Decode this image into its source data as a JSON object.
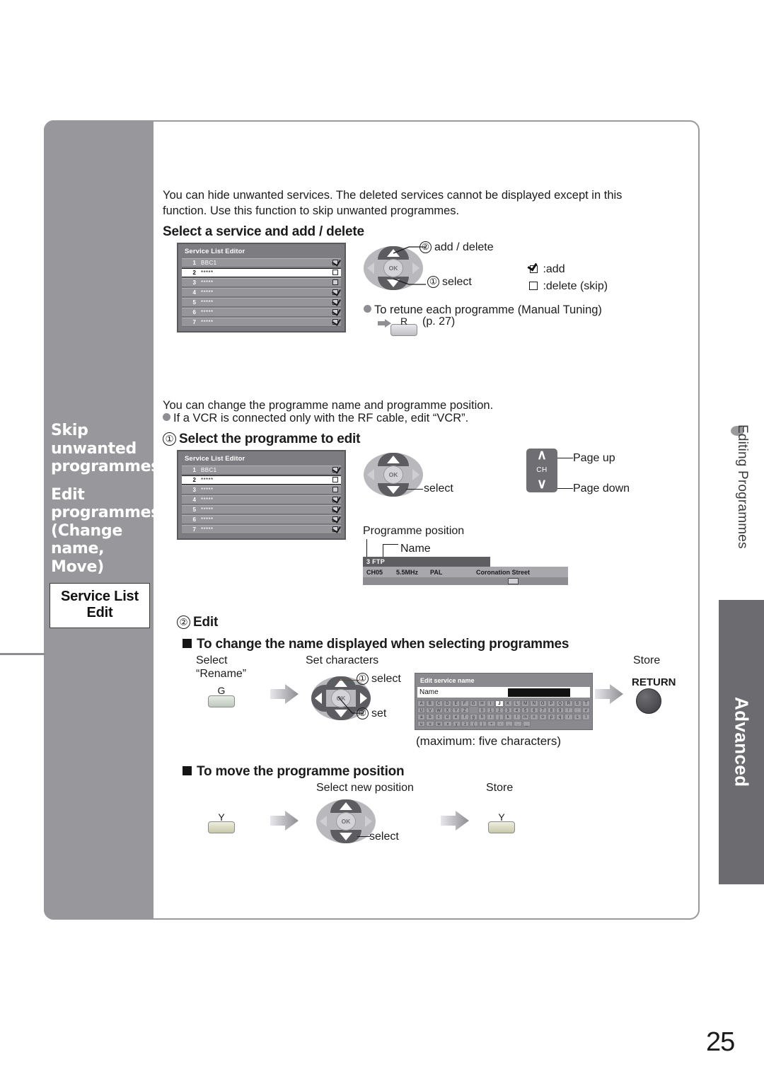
{
  "page": {
    "number": "25"
  },
  "sidebar": {
    "headings": [
      "Skip",
      "unwanted",
      "programmes"
    ],
    "headings2": [
      "Edit",
      "programmes",
      "(Change name,",
      " Move)"
    ],
    "box": {
      "line1": "Service List",
      "line2": "Edit"
    }
  },
  "right_tabs": {
    "editing": "Editing Programmes",
    "advanced": "Advanced"
  },
  "section1": {
    "intro_line1": "You can hide unwanted services. The deleted services cannot be displayed except in this",
    "intro_line2": "function. Use this function to skip unwanted programmes.",
    "heading": "Select a service and add / delete",
    "dpad": {
      "step2": "add / delete",
      "num2": "②",
      "step1": "select",
      "num1": "①"
    },
    "legend": {
      "add": ":add",
      "delete": ":delete (skip)"
    },
    "note": "To retune each programme (Manual Tuning)",
    "note_key": "R",
    "note_page": "(p. 27)"
  },
  "service_list": {
    "title": "Service List Editor",
    "rows": [
      {
        "num": "1",
        "name": "BBC1",
        "checked": true,
        "selected": false
      },
      {
        "num": "2",
        "name": "*****",
        "checked": false,
        "selected": true
      },
      {
        "num": "3",
        "name": "*****",
        "checked": false,
        "selected": false
      },
      {
        "num": "4",
        "name": "*****",
        "checked": true,
        "selected": false
      },
      {
        "num": "5",
        "name": "*****",
        "checked": true,
        "selected": false
      },
      {
        "num": "6",
        "name": "*****",
        "checked": true,
        "selected": false
      },
      {
        "num": "7",
        "name": "*****",
        "checked": true,
        "selected": false
      }
    ]
  },
  "section2": {
    "intro": "You can change the programme name and programme position.",
    "bullet": "If a VCR is connected only with the RF cable, edit “VCR”.",
    "step1_num": "①",
    "step1_heading": "Select the programme to edit",
    "dpad_select": "select",
    "ch_rocker": {
      "up": "∧",
      "label": "CH",
      "down": "∨"
    },
    "page_up": "Page up",
    "page_down": "Page down",
    "callout_position": "Programme position",
    "callout_name": "Name"
  },
  "banner": {
    "position": "3",
    "name": "FTP",
    "channel": "CH05",
    "freq": "5.5MHz",
    "system": "PAL",
    "programme": "Coronation Street"
  },
  "section3": {
    "step2_num": "②",
    "step2_heading": "Edit",
    "sub1_heading": "To change the name displayed when selecting programmes",
    "select_line1": "Select",
    "select_line2": "“Rename”",
    "green_key": "G",
    "set_characters": "Set characters",
    "dpad_select_num": "①",
    "dpad_select": "select",
    "dpad_set_num": "②",
    "dpad_set": "set",
    "store": "Store",
    "return_label": "RETURN",
    "maximum": "(maximum: five characters)",
    "sub2_heading": "To move the programme position",
    "select_new_position": "Select new position",
    "move_select": "select",
    "move_store": "Store",
    "yellow_key_1": "Y",
    "yellow_key_2": "Y"
  },
  "edit_service_name": {
    "title": "Edit service name",
    "field_label": "Name",
    "keyboard": [
      [
        "A",
        "B",
        "C",
        "D",
        "E",
        "F",
        "G",
        "H",
        "I",
        "J",
        "K",
        "L",
        "M",
        "N",
        "O",
        "P",
        "Q",
        "R",
        "S",
        "T"
      ],
      [
        "U",
        "V",
        "W",
        "X",
        "Y",
        "Z",
        "",
        "0",
        "1",
        "2",
        "3",
        "4",
        "5",
        "6",
        "7",
        "8",
        "9",
        "!",
        ":",
        "#"
      ],
      [
        "a",
        "b",
        "c",
        "d",
        "e",
        "f",
        "g",
        "h",
        "i",
        "j",
        "k",
        "l",
        "m",
        "n",
        "o",
        "p",
        "q",
        "r",
        "s",
        "t"
      ],
      [
        "u",
        "v",
        "w",
        "x",
        "y",
        "z",
        "(",
        ")",
        "+",
        "-",
        ",",
        ".",
        "_"
      ]
    ],
    "highlighted_key": "J"
  },
  "colors": {
    "sidebar_gray": "#98989c",
    "tab_gray": "#6c6c70",
    "osd_gray": "#7d7d81",
    "accent_dark": "#5d5d61"
  }
}
